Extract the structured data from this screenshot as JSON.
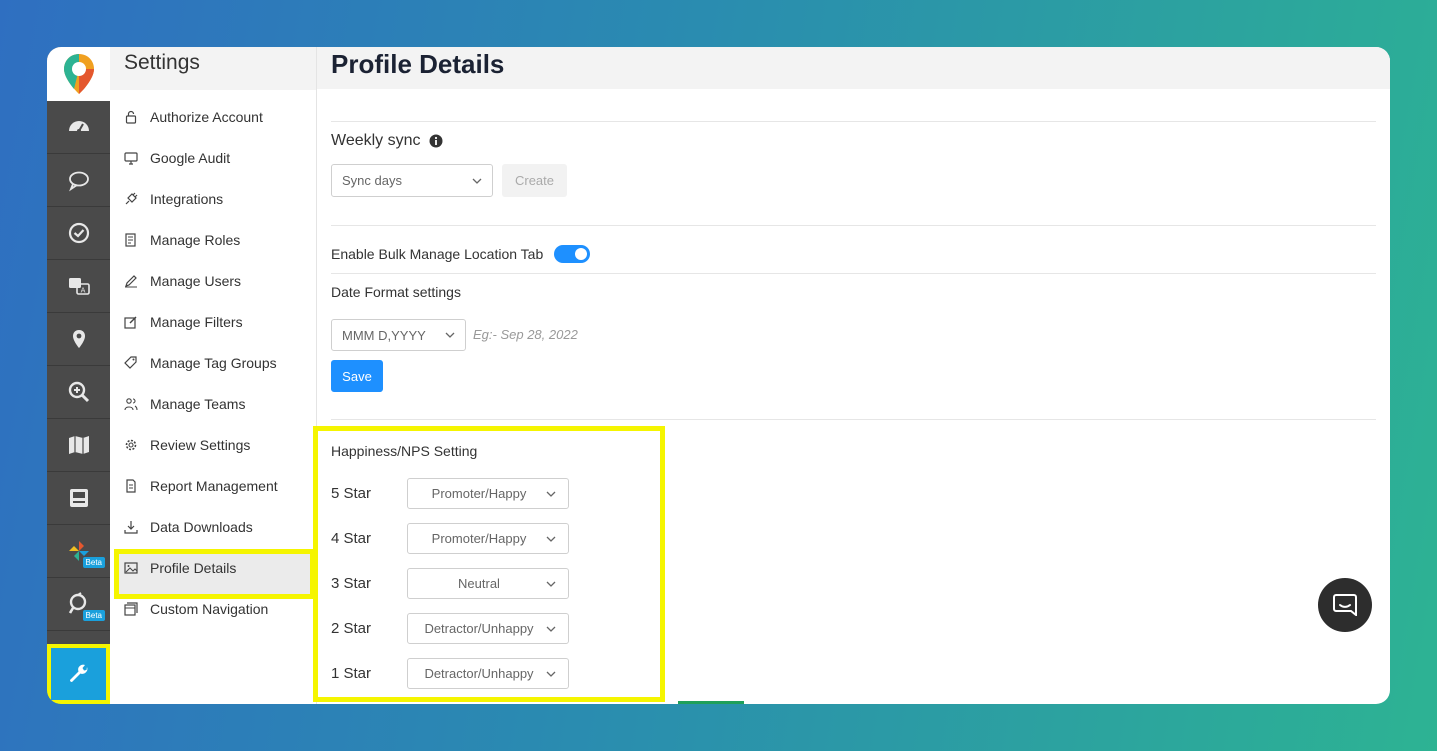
{
  "rail": {
    "items": [
      {
        "icon": "dashboard-icon"
      },
      {
        "icon": "chat-bubble-icon"
      },
      {
        "icon": "check-circle-icon"
      },
      {
        "icon": "translate-icon"
      },
      {
        "icon": "location-pin-icon"
      },
      {
        "icon": "zoom-in-icon"
      },
      {
        "icon": "map-icon"
      },
      {
        "icon": "window-icon"
      },
      {
        "icon": "pinwheel-icon",
        "badge": "Beta"
      },
      {
        "icon": "search-refresh-icon",
        "badge": "Beta"
      },
      {
        "icon": "wrench-icon",
        "active": true
      }
    ]
  },
  "sidebar": {
    "title": "Settings",
    "items": [
      {
        "label": "Authorize Account",
        "icon": "lock-icon"
      },
      {
        "label": "Google Audit",
        "icon": "monitor-icon"
      },
      {
        "label": "Integrations",
        "icon": "plug-icon"
      },
      {
        "label": "Manage Roles",
        "icon": "roles-icon"
      },
      {
        "label": "Manage Users",
        "icon": "pencil-icon"
      },
      {
        "label": "Manage Filters",
        "icon": "edit-box-icon"
      },
      {
        "label": "Manage Tag Groups",
        "icon": "tag-icon"
      },
      {
        "label": "Manage Teams",
        "icon": "team-icon"
      },
      {
        "label": "Review Settings",
        "icon": "gear-icon"
      },
      {
        "label": "Report Management",
        "icon": "document-icon"
      },
      {
        "label": "Data Downloads",
        "icon": "download-icon"
      },
      {
        "label": "Profile Details",
        "icon": "image-icon",
        "active": true
      },
      {
        "label": "Custom Navigation",
        "icon": "window-stack-icon"
      }
    ]
  },
  "main": {
    "title": "Profile Details",
    "weekly_sync": {
      "label": "Weekly sync",
      "select_placeholder": "Sync days",
      "create_label": "Create"
    },
    "bulk_manage": {
      "label": "Enable Bulk Manage Location Tab",
      "enabled": true
    },
    "date_format": {
      "label": "Date Format settings",
      "value": "MMM D,YYYY",
      "example": "Eg:- Sep 28, 2022",
      "save_label": "Save"
    },
    "nps": {
      "title": "Happiness/NPS Setting",
      "rows": [
        {
          "label": "5 Star",
          "value": "Promoter/Happy"
        },
        {
          "label": "4 Star",
          "value": "Promoter/Happy"
        },
        {
          "label": "3 Star",
          "value": "Neutral"
        },
        {
          "label": "2 Star",
          "value": "Detractor/Unhappy"
        },
        {
          "label": "1 Star",
          "value": "Detractor/Unhappy"
        }
      ]
    }
  },
  "colors": {
    "accent": "#1e90ff",
    "highlight": "#f5f500",
    "rail": "#4a4a4a",
    "rail_active": "#1aa0dc"
  }
}
